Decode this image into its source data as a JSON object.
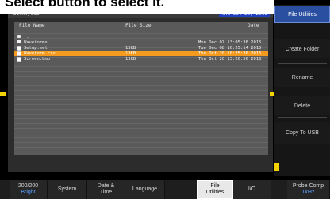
{
  "caption": "Select button to select it.",
  "status": {
    "path": "Disk:/USB",
    "date": "Thu Oct 20, 2016"
  },
  "columns": {
    "name": "File Name",
    "size": "File Size",
    "date": "Date"
  },
  "files": [
    {
      "name": "..",
      "size": "",
      "date": "",
      "icon": "parent-folder-icon",
      "selected": false
    },
    {
      "name": "Waveforms",
      "size": "",
      "date": "Mon Dec 07 13:05:36 2015",
      "icon": "folder-icon",
      "selected": false
    },
    {
      "name": "Setup.set",
      "size": "13KB",
      "date": "Tue Dec 08 10:25:14 2015",
      "icon": "file-icon",
      "selected": false
    },
    {
      "name": "Waveform.csv",
      "size": "13KB",
      "date": "Thu Oct 20 10:25:36 2016",
      "icon": "file-icon",
      "selected": true
    },
    {
      "name": "Screen.bmp",
      "size": "13KB",
      "date": "Thu Oct 20 13:26:56 2016",
      "icon": "image-file-icon",
      "selected": false
    }
  ],
  "side_menu": {
    "title": "File Utilities",
    "items": [
      "Create Folder",
      "Rename",
      "Delete",
      "Copy To USB"
    ]
  },
  "bottom_menu": [
    {
      "label": "200/200",
      "sub": "Bright",
      "active": false
    },
    {
      "label": "System",
      "sub": "",
      "active": false
    },
    {
      "label": "Date & Time",
      "sub": "",
      "active": false
    },
    {
      "label": "Language",
      "sub": "",
      "active": false
    },
    {
      "label": "File Utilities",
      "sub": "",
      "active": true
    },
    {
      "label": "I/O",
      "sub": "",
      "active": false
    },
    {
      "label": "Probe Comp",
      "sub": "1kHz",
      "active": false
    }
  ],
  "colors": {
    "selection": "#f39a1f",
    "date_badge": "#1f3fbf",
    "marker": "#f2d200"
  }
}
